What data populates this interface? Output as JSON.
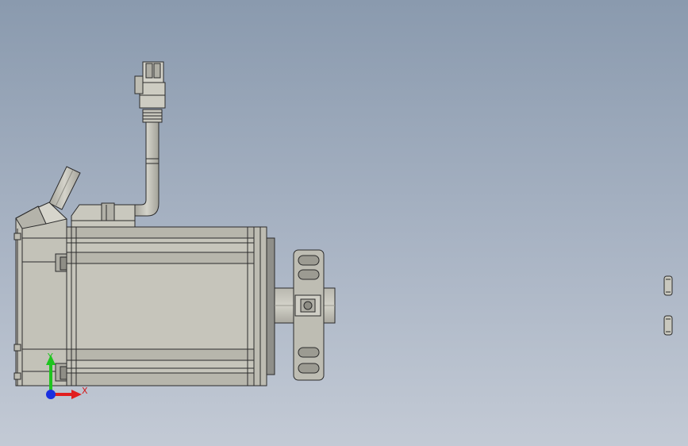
{
  "viewport": {
    "background_top": "#8a9aae",
    "background_bottom": "#c3cad5"
  },
  "model": {
    "body_color": "#c6c5bb",
    "edge_color": "#2b2b2b",
    "shade_color": "#a8a79e"
  },
  "triad": {
    "x_label": "X",
    "y_label": "Y",
    "x_color": "#e11e1e",
    "y_color": "#1fc41f",
    "z_color": "#1a2fe0"
  }
}
